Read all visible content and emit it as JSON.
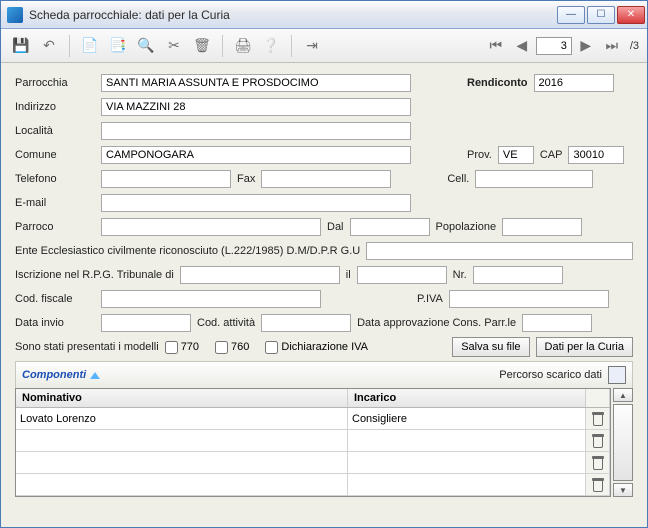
{
  "window": {
    "title": "Scheda parrocchiale: dati per la Curia"
  },
  "pager": {
    "current": "3",
    "total": "/3"
  },
  "labels": {
    "parrocchia": "Parrocchia",
    "rendiconto": "Rendiconto",
    "indirizzo": "Indirizzo",
    "localita": "Località",
    "comune": "Comune",
    "prov": "Prov.",
    "cap": "CAP",
    "telefono": "Telefono",
    "fax": "Fax",
    "cell": "Cell.",
    "email": "E-mail",
    "parroco": "Parroco",
    "dal": "Dal",
    "popolazione": "Popolazione",
    "ente": "Ente Ecclesiastico civilmente riconosciuto (L.222/1985) D.M/D.P.R G.U",
    "iscrizione": "Iscrizione nel R.P.G. Tribunale di",
    "il": "il",
    "nr": "Nr.",
    "codfisc": "Cod. fiscale",
    "piva": "P.IVA",
    "datainvio": "Data invio",
    "codatt": "Cod. attività",
    "dataappr": "Data approvazione Cons. Parr.le",
    "modelli": "Sono stati presentati i modelli",
    "c770": "770",
    "c760": "760",
    "civa": "Dichiarazione IVA",
    "salva": "Salva su file",
    "daticuria": "Dati per la Curia",
    "componenti": "Componenti",
    "percorso": "Percorso scarico dati"
  },
  "values": {
    "parrocchia": "SANTI MARIA ASSUNTA E PROSDOCIMO",
    "rendiconto": "2016",
    "indirizzo": "VIA MAZZINI 28",
    "localita": "",
    "comune": "CAMPONOGARA",
    "prov": "VE",
    "cap": "30010",
    "telefono": "",
    "fax": "",
    "cell": "",
    "email": "",
    "parroco": "",
    "dal": "",
    "popolazione": "",
    "ente": "",
    "tribunale": "",
    "il": "",
    "nr": "",
    "codfisc": "",
    "piva": "",
    "datainvio": "",
    "codatt": "",
    "dataappr": ""
  },
  "grid": {
    "headers": {
      "nominativo": "Nominativo",
      "incarico": "Incarico"
    },
    "rows": [
      {
        "nominativo": "Lovato Lorenzo",
        "incarico": "Consigliere"
      },
      {
        "nominativo": "",
        "incarico": ""
      },
      {
        "nominativo": "",
        "incarico": ""
      },
      {
        "nominativo": "",
        "incarico": ""
      }
    ]
  }
}
